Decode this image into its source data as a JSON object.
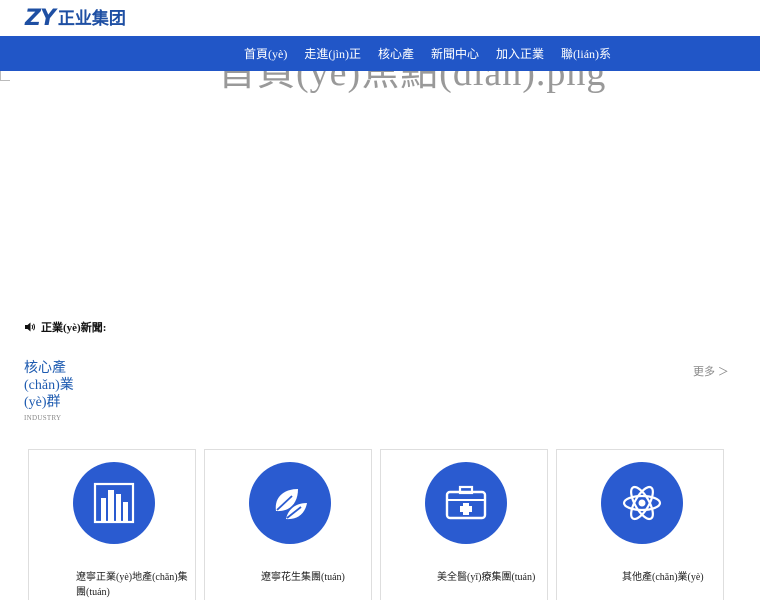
{
  "header": {
    "logo_mark": "ZY",
    "logo_text": "正业集团"
  },
  "nav": {
    "items": [
      {
        "label": "首頁(yè)"
      },
      {
        "label": "走進(jìn)正"
      },
      {
        "label": "核心產"
      },
      {
        "label": "新聞中心"
      },
      {
        "label": "加入正業"
      },
      {
        "label": "聯(lián)系"
      }
    ]
  },
  "banner": {
    "alt_text": "首頁(yè)焦點(diǎn).png"
  },
  "news": {
    "label": "正業(yè)新聞:"
  },
  "section": {
    "title": "核心產(chǎn)業(yè)群",
    "subtitle": "INDUSTRY",
    "more": "更多 ＞"
  },
  "cards": [
    {
      "label": "遼寧正業(yè)地產(chǎn)集團(tuán)",
      "icon": "buildings-icon"
    },
    {
      "label": "遼寧花生集團(tuán)",
      "icon": "leaf-icon"
    },
    {
      "label": "美全醫(yī)療集團(tuán)",
      "icon": "medical-kit-icon"
    },
    {
      "label": "其他產(chǎn)業(yè)",
      "icon": "atom-icon"
    }
  ],
  "colors": {
    "brand": "#1e4fa3",
    "nav_bg": "#2156c7",
    "card_circle": "#2a5bd0"
  }
}
